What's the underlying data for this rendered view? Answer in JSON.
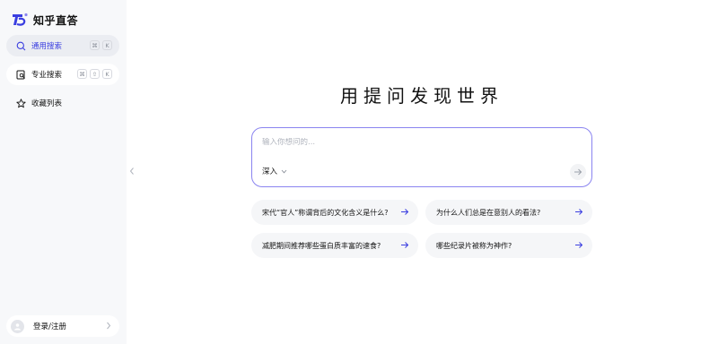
{
  "brand": {
    "name": "知乎直答"
  },
  "sidebar": {
    "items": [
      {
        "label": "通用搜索",
        "keys": [
          "⌘",
          "K"
        ],
        "icon": "search-icon"
      },
      {
        "label": "专业搜索",
        "keys": [
          "⌘",
          "⇧",
          "K"
        ],
        "icon": "document-search-icon"
      },
      {
        "label": "收藏列表",
        "keys": [],
        "icon": "star-icon"
      }
    ],
    "login_label": "登录/注册"
  },
  "main": {
    "title": "用提问发现世界",
    "search": {
      "placeholder": "输入你想问的...",
      "mode_label": "深入"
    },
    "suggestions": [
      "宋代“官人”称谓背后的文化含义是什么?",
      "为什么人们总是在意别人的看法?",
      "减肥期间推荐哪些蛋白质丰富的速食?",
      "哪些纪录片被称为神作?"
    ]
  },
  "colors": {
    "accent": "#3a3ee0",
    "border_accent": "#8a84f0",
    "sidebar_bg": "#f7f8fa",
    "active_bg": "#ebedf2"
  }
}
